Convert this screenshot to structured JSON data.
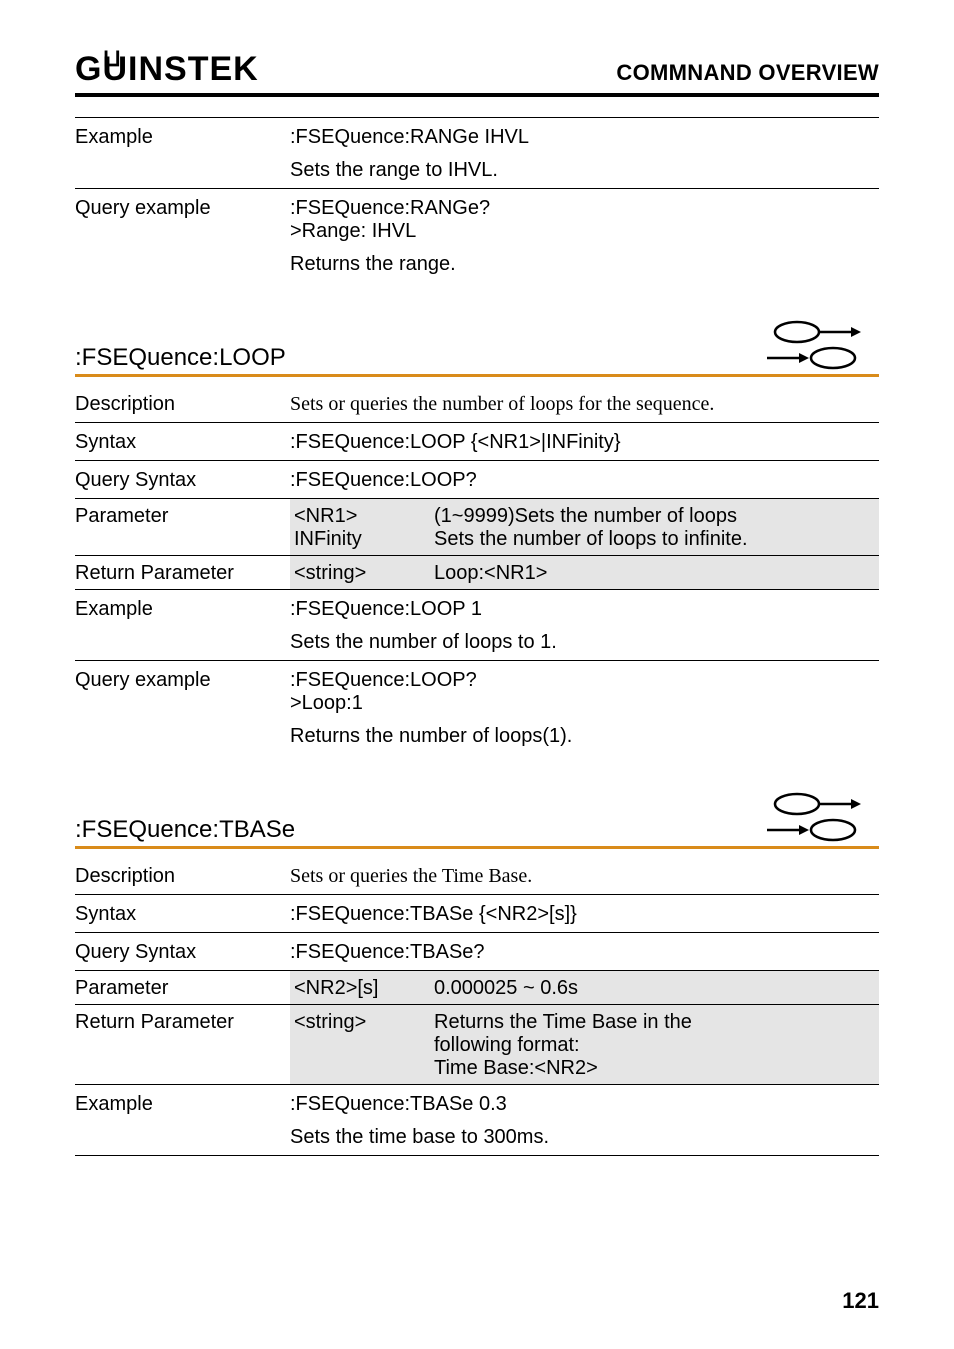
{
  "header": {
    "logo": "GWINSTEK",
    "title": "COMMNAND OVERVIEW"
  },
  "block1": {
    "example_label": "Example",
    "example_cmd": ":FSEQuence:RANGe IHVL",
    "example_desc": "Sets the range to IHVL.",
    "query_label": "Query example",
    "query_cmd": ":FSEQuence:RANGe?",
    "query_resp": ">Range: IHVL",
    "query_desc": "Returns the range."
  },
  "loop": {
    "heading": ":FSEQuence:LOOP",
    "desc_label": "Description",
    "desc_text": "Sets or queries the number of loops for the sequence.",
    "syntax_label": "Syntax",
    "syntax_text": ":FSEQuence:LOOP {<NR1>|INFinity}",
    "qsyntax_label": "Query Syntax",
    "qsyntax_text": ":FSEQuence:LOOP?",
    "param_label": "Parameter",
    "param1_key": "<NR1>",
    "param1_val": "(1~9999)Sets the number of loops",
    "param2_key": "INFinity",
    "param2_val": "Sets the number of loops to infinite.",
    "ret_label": "Return Parameter",
    "ret_key": "<string>",
    "ret_val": "Loop:<NR1>",
    "ex_label": "Example",
    "ex_cmd": ":FSEQuence:LOOP 1",
    "ex_desc": "Sets the number of loops to 1.",
    "qe_label": "Query example",
    "qe_cmd": ":FSEQuence:LOOP?",
    "qe_resp": ">Loop:1",
    "qe_desc": "Returns the number of loops(1)."
  },
  "tbase": {
    "heading": ":FSEQuence:TBASe",
    "desc_label": "Description",
    "desc_text": "Sets or queries the Time Base.",
    "syntax_label": "Syntax",
    "syntax_text": ":FSEQuence:TBASe {<NR2>[s]}",
    "qsyntax_label": "Query Syntax",
    "qsyntax_text": ":FSEQuence:TBASe?",
    "param_label": "Parameter",
    "param_key": "<NR2>[s]",
    "param_val": "0.000025 ~ 0.6s",
    "ret_label": "Return Parameter",
    "ret_key": "<string>",
    "ret_val1": "Returns the Time Base in the",
    "ret_val2": "following format:",
    "ret_val3": "Time Base:<NR2>",
    "ex_label": "Example",
    "ex_cmd": ":FSEQuence:TBASe 0.3",
    "ex_desc": "Sets the time base to 300ms."
  },
  "page": "121"
}
